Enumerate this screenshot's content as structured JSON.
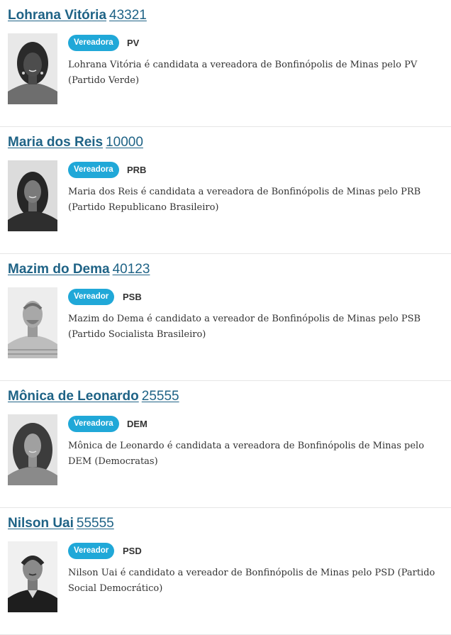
{
  "candidates": [
    {
      "name": "Lohrana Vitória",
      "number": "43321",
      "role": "Vereadora",
      "party": "PV",
      "description": "Lohrana Vitória é candidata a vereadora de Bonfinópolis de Minas pelo PV (Partido Verde)"
    },
    {
      "name": "Maria dos Reis",
      "number": "10000",
      "role": "Vereadora",
      "party": "PRB",
      "description": "Maria dos Reis é candidata a vereadora de Bonfinópolis de Minas pelo PRB (Partido Republicano Brasileiro)"
    },
    {
      "name": "Mazim do Dema",
      "number": "40123",
      "role": "Vereador",
      "party": "PSB",
      "description": "Mazim do Dema é candidato a vereador de Bonfinópolis de Minas pelo PSB (Partido Socialista Brasileiro)"
    },
    {
      "name": "Mônica de Leonardo",
      "number": "25555",
      "role": "Vereadora",
      "party": "DEM",
      "description": "Mônica de Leonardo é candidata a vereadora de Bonfinópolis de Minas pelo DEM (Democratas)"
    },
    {
      "name": "Nilson Uai",
      "number": "55555",
      "role": "Vereador",
      "party": "PSD",
      "description": "Nilson Uai é candidato a vereador de Bonfinópolis de Minas pelo PSD (Partido Social Democrático)"
    }
  ],
  "colors": {
    "link": "#1f6386",
    "badge": "#20a8d8",
    "divider": "#e6e6e6"
  }
}
